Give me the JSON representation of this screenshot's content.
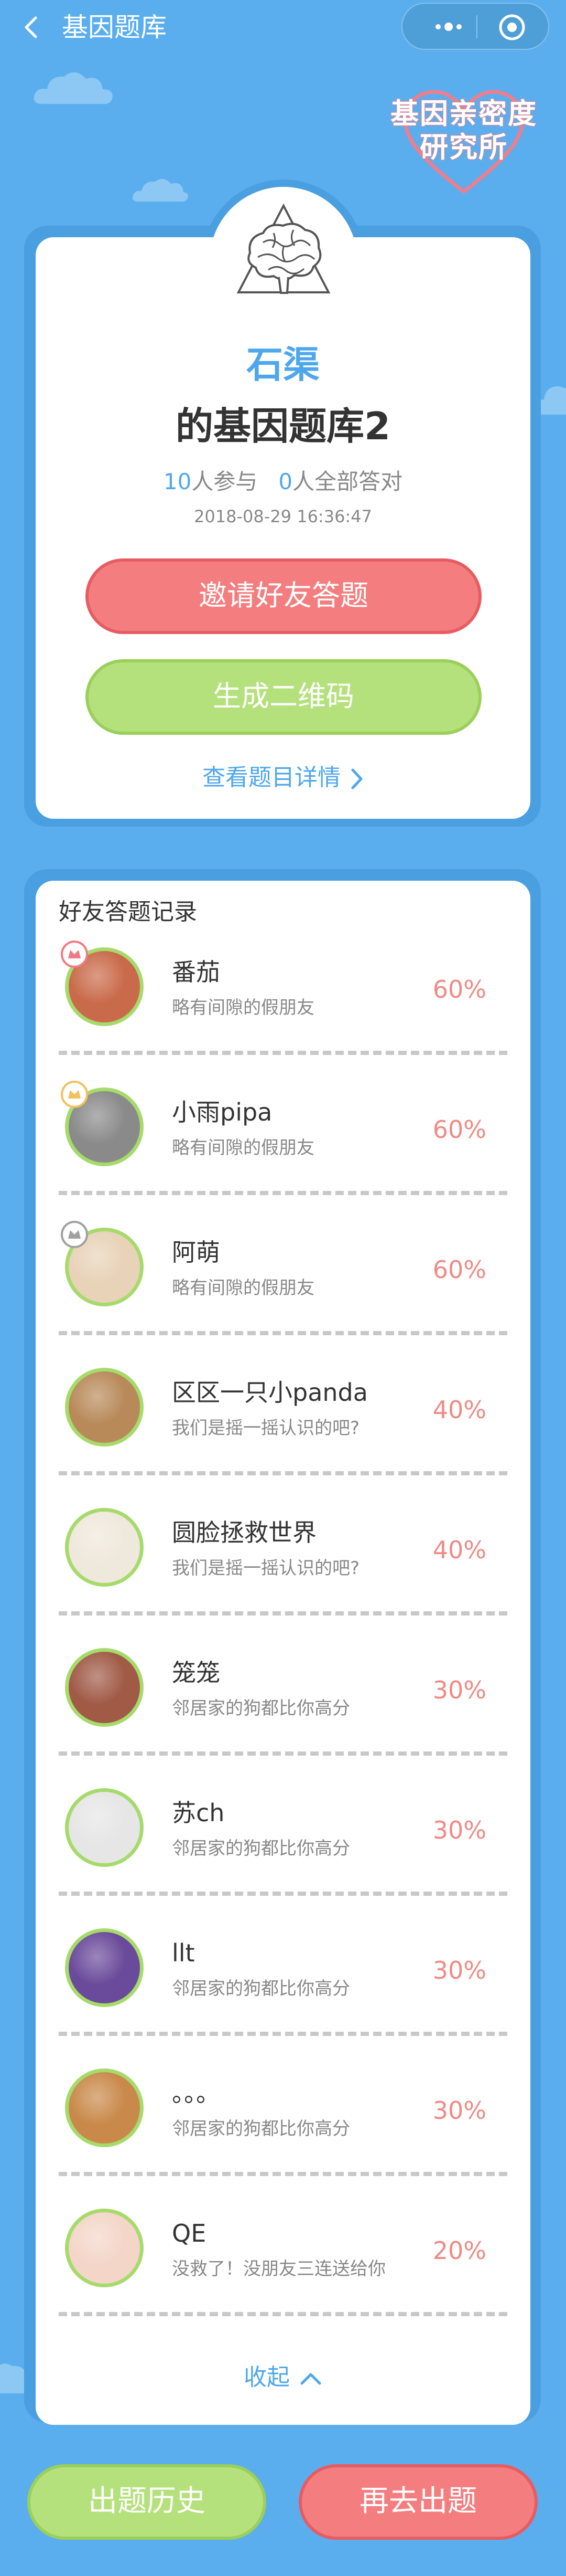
{
  "nav": {
    "title": "基因题库"
  },
  "logo": {
    "line1": "基因亲密度",
    "line2": "研究所"
  },
  "bank": {
    "author": "石渠",
    "title": "的基因题库2",
    "participants": "10",
    "participants_label": "人参与",
    "all_correct": "0",
    "all_correct_label": "人全部答对",
    "date": "2018-08-29  16:36:47"
  },
  "buttons": {
    "invite": "邀请好友答题",
    "qrcode": "生成二维码",
    "details": "查看题目详情",
    "collapse": "收起",
    "history": "出题历史",
    "again": "再去出题"
  },
  "records": {
    "title": "好友答题记录",
    "items": [
      {
        "name": "番茄",
        "desc": "略有间隙的假朋友",
        "score": "60%",
        "badge": "#f07a83"
      },
      {
        "name": "小雨pipa",
        "desc": "略有间隙的假朋友",
        "score": "60%",
        "badge": "#f2c15e"
      },
      {
        "name": "阿萌",
        "desc": "略有间隙的假朋友",
        "score": "60%",
        "badge": "#a0a0a0"
      },
      {
        "name": "区区一只小panda",
        "desc": "我们是摇一摇认识的吧?",
        "score": "40%",
        "badge": ""
      },
      {
        "name": "圆脸拯救世界",
        "desc": "我们是摇一摇认识的吧?",
        "score": "40%",
        "badge": ""
      },
      {
        "name": "笼笼",
        "desc": "邻居家的狗都比你高分",
        "score": "30%",
        "badge": ""
      },
      {
        "name": "苏ch⁣",
        "desc": "邻居家的狗都比你高分",
        "score": "30%",
        "badge": ""
      },
      {
        "name": "llt",
        "desc": "邻居家的狗都比你高分",
        "score": "30%",
        "badge": ""
      },
      {
        "name": "⁣。。。",
        "desc": "邻居家的狗都比你高分",
        "score": "30%",
        "badge": ""
      },
      {
        "name": "QE",
        "desc": "没救了！没朋友三连送给你",
        "score": "20%",
        "badge": ""
      }
    ]
  },
  "colors": {
    "background": "#5baeed",
    "accent": "#4ea7ec",
    "pink": "#f47e7f",
    "green": "#b5e17c"
  }
}
